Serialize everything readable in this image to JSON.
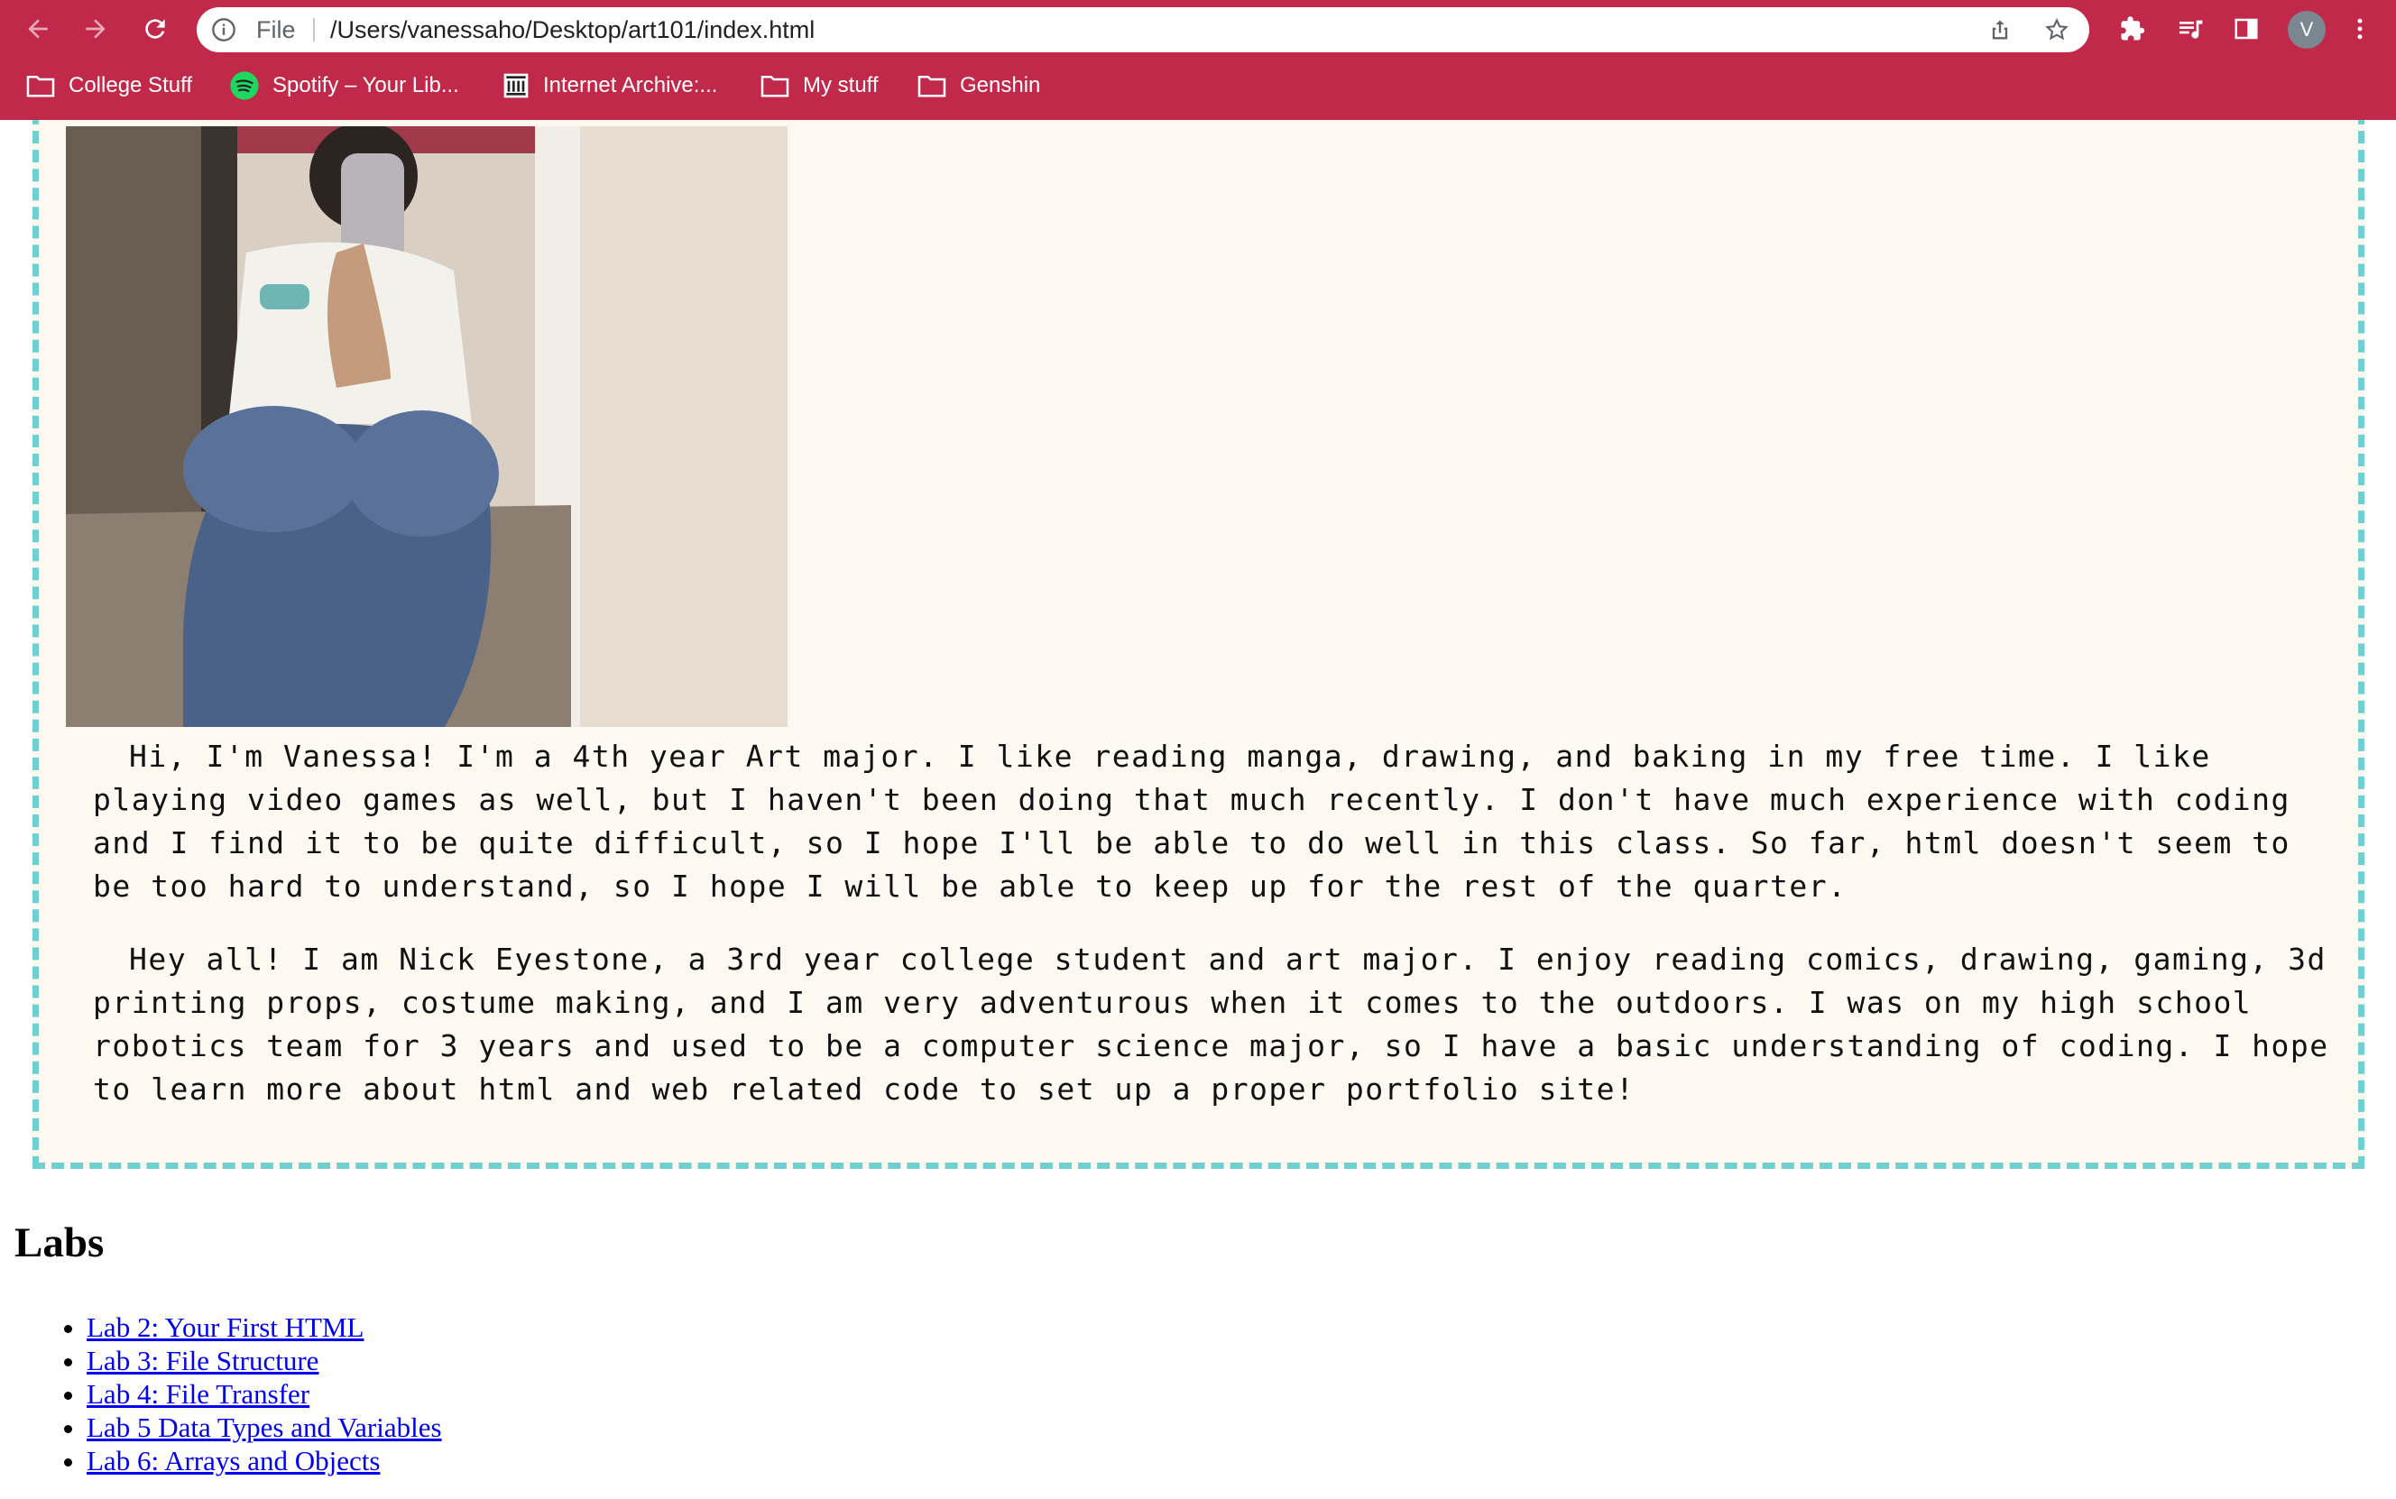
{
  "browser": {
    "address_scheme": "File",
    "address_url": "/Users/vanessaho/Desktop/art101/index.html",
    "profile_initial": "V",
    "icons": {
      "back": "arrow-left-icon",
      "forward": "arrow-right-icon",
      "reload": "reload-icon",
      "info": "info-icon",
      "share": "share-icon",
      "bookmark": "star-icon",
      "extensions": "puzzle-icon",
      "media": "media-queue-icon",
      "side_panel": "side-panel-icon",
      "menu": "kebab-menu-icon"
    },
    "colors": {
      "chrome": "#c0294a",
      "omnibox": "#ffffff"
    }
  },
  "bookmarks": [
    {
      "label": "College Stuff",
      "icon": "folder-icon"
    },
    {
      "label": "Spotify – Your Lib...",
      "icon": "spotify-icon"
    },
    {
      "label": "Internet Archive:...",
      "icon": "archive-icon"
    },
    {
      "label": "My stuff",
      "icon": "folder-icon"
    },
    {
      "label": "Genshin",
      "icon": "folder-icon"
    }
  ],
  "page": {
    "card_border_color": "#6fd0cf",
    "card_background": "#fdf8f0",
    "bios": [
      "Hi, I'm Vanessa! I'm a 4th year Art major. I like reading manga, drawing, and baking in my free time. I like playing video games as well, but I haven't been doing that much recently. I don't have much experience with coding and I find it to be quite difficult, so I hope I'll be able to do well in this class. So far, html doesn't seem to be too hard to understand, so I hope I will be able to keep up for the rest of the quarter.",
      "Hey all! I am Nick Eyestone, a 3rd year college student and art major. I enjoy reading comics, drawing, gaming, 3d printing props, costume making, and I am very adventurous when it comes to the outdoors. I was on my high school robotics team for 3 years and used to be a computer science major, so I have a basic understanding of coding. I hope to learn more about html and web related code to set up a proper portfolio site!"
    ],
    "labs_heading": "Labs",
    "labs": [
      {
        "label": "Lab 2: Your First HTML"
      },
      {
        "label": "Lab 3: File Structure"
      },
      {
        "label": "Lab 4: File Transfer"
      },
      {
        "label": "Lab 5 Data Types and Variables"
      },
      {
        "label": "Lab 6: Arrays and Objects"
      }
    ]
  }
}
